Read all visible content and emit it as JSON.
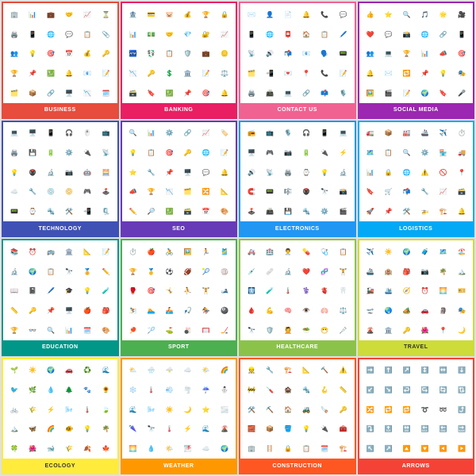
{
  "cards": [
    {
      "id": "business",
      "label": "BUSINESS",
      "borderClass": "card-business",
      "barClass": "bar-business",
      "icons": [
        "🏢",
        "📊",
        "💼",
        "🤝",
        "📈",
        "⏳",
        "🖨️",
        "📱",
        "🌐",
        "💬",
        "📋",
        "📎",
        "👥",
        "💡",
        "🎯",
        "📅",
        "💰",
        "🔑",
        "🏆",
        "📌",
        "💹",
        "🔔",
        "📧",
        "📝",
        "🗂️",
        "📦",
        "🔗",
        "🖥️",
        "📉",
        "🗓️"
      ]
    },
    {
      "id": "banking",
      "label": "BANKING",
      "borderClass": "card-banking",
      "barClass": "bar-banking",
      "icons": [
        "🏦",
        "💳",
        "🐷",
        "💰",
        "🏆",
        "🔒",
        "📊",
        "💵",
        "🤝",
        "💎",
        "🔐",
        "📈",
        "🏧",
        "💱",
        "📋",
        "🛡️",
        "💼",
        "🪙",
        "📉",
        "🔑",
        "💲",
        "🏛️",
        "📝",
        "⚖️",
        "🗃️",
        "🔖",
        "💹",
        "📌",
        "🎯",
        "🔔"
      ]
    },
    {
      "id": "contact",
      "label": "CONTACT US",
      "borderClass": "card-contact",
      "barClass": "bar-contact",
      "icons": [
        "✉️",
        "👤",
        "📄",
        "🔔",
        "📞",
        "💬",
        "📱",
        "🌐",
        "📮",
        "🏠",
        "📋",
        "🖊️",
        "📡",
        "🔊",
        "📬",
        "📧",
        "🗣️",
        "📟",
        "🗂️",
        "📲",
        "💌",
        "📍",
        "📞",
        "📝",
        "🖨️",
        "📠",
        "💻",
        "🔗",
        "📫",
        "🎙️"
      ]
    },
    {
      "id": "social",
      "label": "SOCIAL MEDIA",
      "borderClass": "card-social",
      "barClass": "bar-social",
      "icons": [
        "👍",
        "⭐",
        "🔍",
        "🎵",
        "🌟",
        "🎥",
        "❤️",
        "💬",
        "📸",
        "🌐",
        "🔗",
        "📱",
        "👥",
        "💻",
        "🏆",
        "📊",
        "📣",
        "🎯",
        "🔔",
        "✉️",
        "🔁",
        "📌",
        "💡",
        "🎭",
        "🖼️",
        "🎬",
        "📝",
        "🌍",
        "🔖",
        "🎤"
      ]
    },
    {
      "id": "technology",
      "label": "TECHNOLOGY",
      "borderClass": "card-technology",
      "barClass": "bar-technology",
      "icons": [
        "💻",
        "🖥️",
        "📱",
        "🎧",
        "🖱️",
        "📺",
        "🖨️",
        "💾",
        "🔋",
        "⚙️",
        "🔌",
        "📡",
        "💡",
        "🖲️",
        "🔬",
        "📷",
        "🤖",
        "🧮",
        "☁️",
        "🔧",
        "💿",
        "📀",
        "🎮",
        "🕹️",
        "📟",
        "⌚",
        "🔩",
        "🛠️",
        "📲",
        "🗜️"
      ]
    },
    {
      "id": "seo",
      "label": "SEO",
      "borderClass": "card-seo",
      "barClass": "bar-seo",
      "icons": [
        "🔍",
        "📊",
        "⚙️",
        "🔗",
        "📈",
        "🏷️",
        "💡",
        "📋",
        "🎯",
        "🔑",
        "🌐",
        "📝",
        "⭐",
        "🔧",
        "📌",
        "🖥️",
        "💬",
        "🔔",
        "📣",
        "🏆",
        "📉",
        "🗂️",
        "🔀",
        "📐",
        "✏️",
        "🔎",
        "💹",
        "🗃️",
        "📅",
        "🎨"
      ]
    },
    {
      "id": "electronics",
      "label": "ELECTRONICS",
      "borderClass": "card-electronics",
      "barClass": "bar-electronics",
      "icons": [
        "📻",
        "📺",
        "🎙️",
        "🎧",
        "📱",
        "💻",
        "🖥️",
        "🎮",
        "📷",
        "🔋",
        "🔌",
        "⚡",
        "🔊",
        "📡",
        "🖨️",
        "⌚",
        "💡",
        "🔬",
        "🧲",
        "📟",
        "🎼",
        "🖲️",
        "🔭",
        "📸",
        "🕹️",
        "📠",
        "💾",
        "🔩",
        "⚙️",
        "🎬"
      ]
    },
    {
      "id": "logistics",
      "label": "LOGISTICS",
      "borderClass": "card-logistics",
      "barClass": "bar-logistics",
      "icons": [
        "🚛",
        "📦",
        "🏭",
        "🚢",
        "✈️",
        "⏱️",
        "🗺️",
        "📋",
        "🔍",
        "⚙️",
        "🏪",
        "🚚",
        "📊",
        "🔒",
        "🌐",
        "⚠️",
        "🚫",
        "📍",
        "🔖",
        "🛒",
        "📬",
        "🔧",
        "📈",
        "🗃️",
        "🚀",
        "📌",
        "🛠️",
        "🚁",
        "🏗️",
        "🔔"
      ]
    },
    {
      "id": "education",
      "label": "EDUCATION",
      "borderClass": "card-education",
      "barClass": "bar-education",
      "icons": [
        "📚",
        "⏰",
        "🚌",
        "🏛️",
        "📐",
        "📝",
        "🔬",
        "🌍",
        "📋",
        "🔭",
        "🏅",
        "✏️",
        "📖",
        "📓",
        "🖊️",
        "🎓",
        "💡",
        "🧪",
        "📏",
        "🔑",
        "📌",
        "🖥️",
        "🍎",
        "🎒",
        "🏆",
        "👓",
        "🔍",
        "📊",
        "🗓️",
        "🎨"
      ]
    },
    {
      "id": "sport",
      "label": "SPORT",
      "borderClass": "card-sport",
      "barClass": "bar-sport",
      "icons": [
        "⏱️",
        "🍎",
        "🚴",
        "🖼️",
        "🏃",
        "🎽",
        "🏆",
        "🥇",
        "⚽",
        "🏈",
        "🎾",
        "🏐",
        "🥊",
        "🎯",
        "🤸",
        "⛹️",
        "🏋️",
        "🎿",
        "⛷️",
        "🏊",
        "🚣",
        "🎣",
        "🏇",
        "🎱",
        "🏓",
        "🏸",
        "⛳",
        "🎳",
        "🥅",
        "🏒"
      ]
    },
    {
      "id": "healthcare",
      "label": "HEALTHCARE",
      "borderClass": "card-healthcare",
      "barClass": "bar-healthcare",
      "icons": [
        "🚑",
        "🏥",
        "👨‍⚕️",
        "💊",
        "🩺",
        "📋",
        "💉",
        "🩹",
        "🔬",
        "❤️",
        "🧬",
        "🏋️",
        "🩻",
        "🧪",
        "🌡️",
        "⚕️",
        "🫀",
        "🦷",
        "🩸",
        "💪",
        "🧠",
        "👁️",
        "🫁",
        "⚖️",
        "🔭",
        "🛡️",
        "💆",
        "🥗",
        "😷",
        "🩼"
      ]
    },
    {
      "id": "travel",
      "label": "TRAVEL",
      "borderClass": "card-travel",
      "barClass": "bar-travel",
      "icons": [
        "✈️",
        "☀️",
        "🌍",
        "🧳",
        "🗺️",
        "🏖️",
        "🚢",
        "🏨",
        "🎒",
        "📷",
        "🌴",
        "🏔️",
        "🚂",
        "🛳️",
        "🧭",
        "⏰",
        "🌅",
        "🎫",
        "🛫",
        "🌏",
        "🏕️",
        "🚗",
        "🗿",
        "🎭",
        "🌋",
        "🏛️",
        "🔑",
        "🌺",
        "📍",
        "🌙"
      ]
    },
    {
      "id": "ecology",
      "label": "ECOLOGY",
      "borderClass": "card-ecology",
      "barClass": "bar-ecology",
      "icons": [
        "🌱",
        "☀️",
        "🌍",
        "🚗",
        "♻️",
        "🌊",
        "🐦",
        "🌿",
        "💧",
        "🌲",
        "🐾",
        "🌻",
        "🚲",
        "🌾",
        "⚡",
        "🌬️",
        "🌡️",
        "🍃",
        "🏔️",
        "🦋",
        "🌈",
        "🐠",
        "💡",
        "🌴",
        "🍀",
        "🌺",
        "🐋",
        "🌾",
        "🍂",
        "🍁"
      ]
    },
    {
      "id": "weather",
      "label": "WEATHER",
      "borderClass": "card-weather",
      "barClass": "bar-weather",
      "icons": [
        "⛅",
        "🌧️",
        "🌩️",
        "☁️",
        "🌤️",
        "🌈",
        "❄️",
        "🌡️",
        "💨",
        "🌪️",
        "☔",
        "⛄",
        "🌊",
        "🌬️",
        "☀️",
        "🌙",
        "⭐",
        "🌫️",
        "🌂",
        "🔭",
        "🌡️",
        "⚡",
        "🌊",
        "🌋",
        "🌅",
        "💧",
        "🌤️",
        "🌁",
        "☁️",
        "🌍"
      ]
    },
    {
      "id": "construction",
      "label": "CONSTRUCTION",
      "borderClass": "card-construction",
      "barClass": "bar-construction",
      "icons": [
        "👷",
        "🔧",
        "🏗️",
        "📐",
        "🔨",
        "⚠️",
        "🚧",
        "🪛",
        "🏚️",
        "🔩",
        "🪝",
        "📏",
        "🛠️",
        "⛏️",
        "🏠",
        "🚜",
        "🪚",
        "🔑",
        "🧱",
        "📦",
        "🪣",
        "💡",
        "🔌",
        "🧰",
        "🏢",
        "🪜",
        "🔒",
        "📋",
        "🗓️",
        "🏗️"
      ]
    },
    {
      "id": "arrows",
      "label": "ARROWS",
      "borderClass": "card-arrows",
      "barClass": "bar-arrows",
      "icons": [
        "➡️",
        "⬆️",
        "↗️",
        "↕️",
        "↔️",
        "⬇️",
        "↙️",
        "↘️",
        "↩️",
        "↪️",
        "🔄",
        "🔃",
        "🔀",
        "🔁",
        "🔂",
        "➰",
        "➿",
        "⤴️",
        "⤵️",
        "🔝",
        "🔛",
        "🔙",
        "🔚",
        "🔜",
        "↖️",
        "↗️",
        "🔼",
        "🔽",
        "◀️",
        "▶️"
      ]
    }
  ]
}
